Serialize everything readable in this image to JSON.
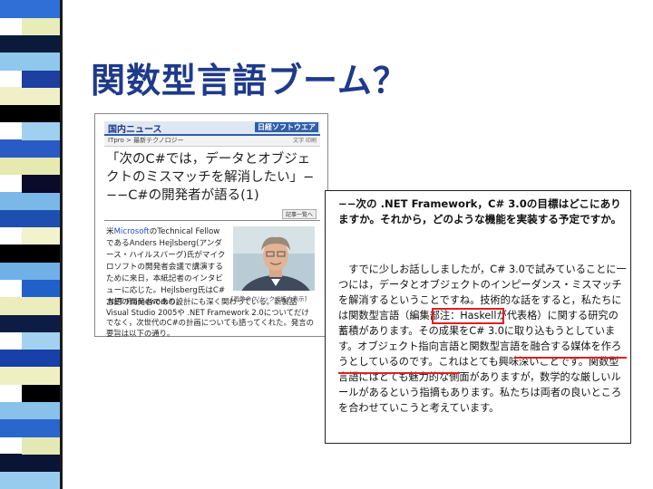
{
  "slide": {
    "title": "関数型言語ブーム？"
  },
  "colors": {
    "title": "#1f3a8a",
    "highlight": "#e02020",
    "stripe": [
      "#2f6fd6",
      "#e8ecb8",
      "#0a1a3a",
      "#8fc8ec",
      "#1c3fa0",
      "#f0f0c8",
      "#000000",
      "#9fd0ef",
      "#2a5bc4",
      "#e6e9b0",
      "#0a0a2a",
      "#7ab8e8",
      "#1e4fb0",
      "#f2f2cc",
      "#000000",
      "#6fb0e6",
      "#2060c8",
      "#ececbc",
      "#0c1c44",
      "#a2d2f0",
      "#1840a8",
      "#eef0c2",
      "#000000",
      "#88c2ea",
      "#2a66cc",
      "#e4e8b4",
      "#0a1434",
      "#98ccef"
    ]
  },
  "article": {
    "section": "国内ニュース",
    "brand": "日経ソフトウエア",
    "breadcrumb": "ITpro > 最新テクノロジー",
    "breadcrumb_ctrl": "文字 印刷",
    "headline": "「次のC#では，データとオブジェクトのミスマッチを解消したい」−−−C#の開発者が語る(1)",
    "related": "記事一覧へ",
    "body_prefix": "米",
    "body_company": "Microsoft",
    "body_rest": "のTechnical FellowであるAnders Hejlsberg(アンダース・ハイルスバーグ)氏がマイクロソフトの開発者会議で講演するために来日，本紙記者のインタビューに応じた。Hejlsberg氏はC#言語の開発者であり，",
    "caption": "[画像のクリックで拡大表示]",
    "body2": ".NET Frameworkの設計にも深く関わっている。新製品Visual Studio 2005や .NET Framework 2.0についてだけでなく，次世代のC#の計画についても語ってくれた。発言の要旨は以下の通り。"
  },
  "quote": {
    "question": "−−次の .NET Framework，C# 3.0の目標はどこにありますか。それから，どのような機能を実装する予定ですか。",
    "answer": "　すでに少しお話ししましたが，C# 3.0で試みていることに一つには，データとオブジェクトのインピーダンス・ミスマッチを解消するということですね。技術的な話をすると，私たちには関数型言語（編集部注：Haskellが代表格）に関する研究の蓄積があります。その成果をC# 3.0に取り込もうとしています。オブジェクト指向言語と関数型言語を融合する媒体を作ろうとしているのです。これはとても興味深いことです。関数型言語にはとても魅力的な側面がありますが，数学的な厳しいルールがあるという指摘もあります。私たちは両者の良いところを合わせていこうと考えています。"
  }
}
